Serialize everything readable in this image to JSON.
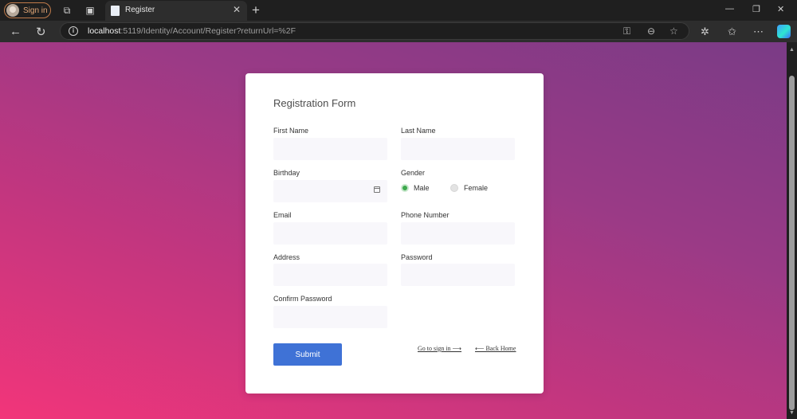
{
  "browser": {
    "signin_label": "Sign in",
    "tab_title": "Register",
    "url_host": "localhost",
    "url_rest": ":5119/Identity/Account/Register?returnUrl=%2F"
  },
  "form": {
    "title": "Registration Form",
    "first_name_label": "First Name",
    "last_name_label": "Last Name",
    "birthday_label": "Birthday",
    "gender_label": "Gender",
    "gender_options": [
      {
        "label": "Male",
        "selected": true
      },
      {
        "label": "Female",
        "selected": false
      }
    ],
    "email_label": "Email",
    "phone_label": "Phone Number",
    "address_label": "Address",
    "password_label": "Password",
    "confirm_password_label": "Confirm Password",
    "submit_label": "Submit",
    "signin_link": "Go to sign in ⟶",
    "home_link": "⟵ Back Home"
  },
  "colors": {
    "accent": "#3f72d6",
    "radio_selected": "#3ea94e",
    "gradient_start": "#f2357a",
    "gradient_end": "#7a3b86"
  }
}
